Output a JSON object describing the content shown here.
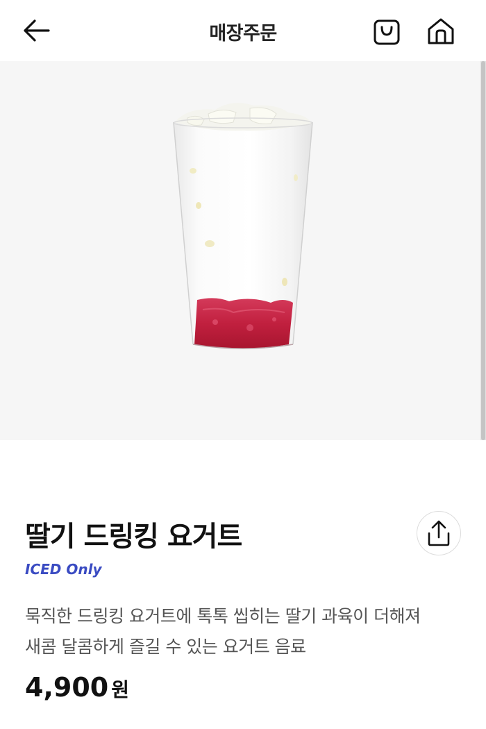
{
  "header": {
    "title": "매장주문",
    "back_icon": "arrow-left-icon",
    "cart_icon": "shopping-bag-icon",
    "home_icon": "home-icon"
  },
  "product": {
    "image": "strawberry-yogurt-drink",
    "name": "딸기 드링킹 요거트",
    "tag": "ICED Only",
    "description_lines": [
      "묵직한 드링킹 요거트에 톡톡 씹히는 딸기 과육이 더해져",
      "새콤 달콤하게 즐길 수 있는 요거트 음료"
    ],
    "price_amount": "4,900",
    "price_unit": "원",
    "share_icon": "share-icon"
  },
  "colors": {
    "accent_tag": "#3a4bc2",
    "hero_bg": "#f6f6f6"
  }
}
